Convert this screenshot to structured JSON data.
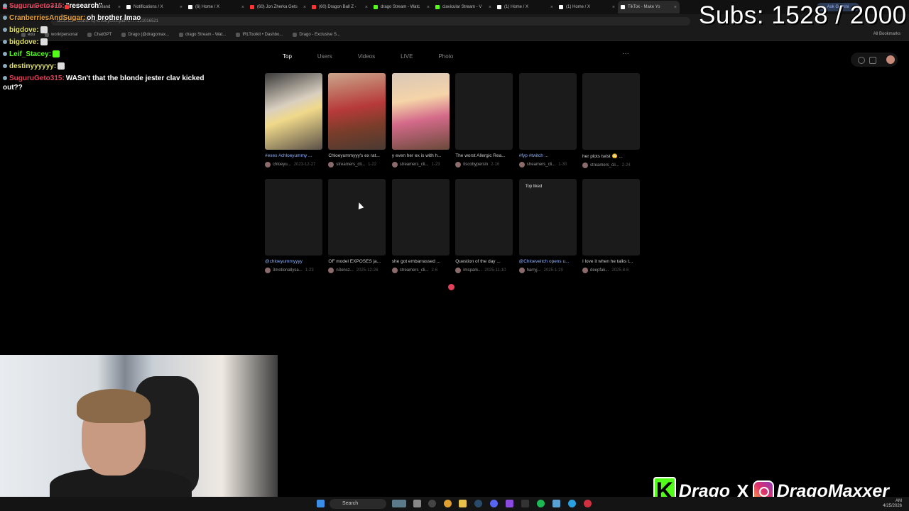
{
  "browser": {
    "tabs": [
      {
        "label": "SuguruGeto315: research",
        "color": "#e0405a"
      },
      {
        "label": "(60) Sean Strickland",
        "color": "#ff3333"
      },
      {
        "label": "Notifications / X",
        "color": "#ffffff"
      },
      {
        "label": "(6) Home / X",
        "color": "#ffffff"
      },
      {
        "label": "(60) Jon Zherka Gets",
        "color": "#ff3333"
      },
      {
        "label": "(60) Dragon Ball Z -",
        "color": "#ff3333"
      },
      {
        "label": "drago Stream - Watc",
        "color": "#53fc18"
      },
      {
        "label": "clavicular Stream - V",
        "color": "#53fc18"
      },
      {
        "label": "(1) Home / X",
        "color": "#ffffff"
      },
      {
        "label": "(1) Home / X",
        "color": "#ffffff"
      },
      {
        "label": "TikTok - Make Yo",
        "color": "#ffffff"
      }
    ],
    "gemini_label": "Ask Gemini",
    "url": "tiktok.com/search?q=chloeyummy&t=1777121016521",
    "bookmarks": [
      "edu",
      "work/personal",
      "ChatGPT",
      "Drago (@dragomax...",
      "drago Stream - Wat...",
      "IRLToolkit • Dashbo...",
      "Drago - Exclusive S..."
    ],
    "all_bookmarks": "All Bookmarks"
  },
  "overlay": {
    "subs": "Subs: 1528 / 2000",
    "kick_letter": "K",
    "kick_name": "Drago",
    "x_glyph": "X",
    "ig_name": "DragoMaxxer"
  },
  "chat": [
    {
      "user": "SuguruGeto315:",
      "text": "\"research\"",
      "color": "#e0405a",
      "emote": ""
    },
    {
      "user": "CranberriesAndSugar:",
      "text": "oh brother lmao",
      "color": "#e8a33a",
      "emote": ""
    },
    {
      "user": "bigdove:",
      "text": "",
      "color": "#e0e070",
      "emote": "#dddddd"
    },
    {
      "user": "bigdove:",
      "text": "",
      "color": "#e0e070",
      "emote": "#dddddd"
    },
    {
      "user": "Leif_Stacey:",
      "text": "",
      "color": "#53fc18",
      "emote": "#53fc18"
    },
    {
      "user": "destinyyyyyy:",
      "text": "",
      "color": "#e0e070",
      "emote": "#dddddd"
    },
    {
      "user": "SuguruGeto315:",
      "text": "WASn't that the blonde jester clav kicked out??",
      "color": "#e0405a",
      "emote": ""
    }
  ],
  "tiktok": {
    "tabs": [
      "Top",
      "Users",
      "Videos",
      "LIVE",
      "Photo"
    ],
    "active_tab": "Top",
    "more": "···",
    "cards": [
      {
        "caption": "#exes #chloeyummy ...",
        "user": "chloeyu...",
        "date": "2023-12-27",
        "tag": true,
        "label": ""
      },
      {
        "caption": "Chloeyummyyy's ex rat...",
        "user": "streamers_cli...",
        "date": "1-22",
        "tag": false,
        "label": ""
      },
      {
        "caption": "y even her ex is with h...",
        "user": "streamers_cli...",
        "date": "1-23",
        "tag": false,
        "label": ""
      },
      {
        "caption": "The worst Allergic Rea...",
        "user": "itscobypersin",
        "date": "2-16",
        "tag": false,
        "label": ""
      },
      {
        "caption": "#fyp #twitch ...",
        "user": "streamers_cli...",
        "date": "1-30",
        "tag": true,
        "label": ""
      },
      {
        "caption": "her plots twist 😳 ...",
        "user": "streamers_cli...",
        "date": "2-24",
        "tag": false,
        "label": ""
      },
      {
        "caption": "@chloeyummyyyy",
        "user": "3motionallysa...",
        "date": "1-23",
        "tag": true,
        "label": ""
      },
      {
        "caption": "OF model EXPOSES ja...",
        "user": "n3onsz...",
        "date": "2025-12-26",
        "tag": false,
        "label": ""
      },
      {
        "caption": "she got embarrassed ...",
        "user": "streamers_cli...",
        "date": "2-6",
        "tag": false,
        "label": ""
      },
      {
        "caption": "Question of the day ...",
        "user": "imspark...",
        "date": "2025-11-10",
        "tag": false,
        "label": ""
      },
      {
        "caption": "@Chloeveitch opens u...",
        "user": "harryj...",
        "date": "2025-1-20",
        "tag": true,
        "label": "Top liked"
      },
      {
        "caption": "I love it when he talks t...",
        "user": "deepfak...",
        "date": "2025-8-6",
        "tag": false,
        "label": ""
      }
    ]
  },
  "taskbar": {
    "search_label": "Search",
    "time": "AM",
    "date": "4/25/2026"
  }
}
